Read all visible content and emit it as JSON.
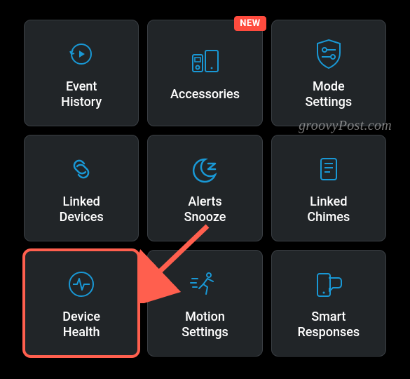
{
  "accent_color": "#1998d5",
  "highlight_color": "#ff5f4e",
  "badge_color": "#ff4b3e",
  "watermark": "groovyPost.com",
  "tiles": [
    {
      "label": "Event\nHistory",
      "icon": "clock-play",
      "badge": null,
      "highlight": false,
      "name": "tile-event-history"
    },
    {
      "label": "Accessories",
      "icon": "devices",
      "badge": "NEW",
      "highlight": false,
      "name": "tile-accessories"
    },
    {
      "label": "Mode\nSettings",
      "icon": "shield-toggle",
      "badge": null,
      "highlight": false,
      "name": "tile-mode-settings"
    },
    {
      "label": "Linked\nDevices",
      "icon": "link",
      "badge": null,
      "highlight": false,
      "name": "tile-linked-devices"
    },
    {
      "label": "Alerts\nSnooze",
      "icon": "moon-snooze",
      "badge": null,
      "highlight": false,
      "name": "tile-alerts-snooze"
    },
    {
      "label": "Linked\nChimes",
      "icon": "doc-lines",
      "badge": null,
      "highlight": false,
      "name": "tile-linked-chimes"
    },
    {
      "label": "Device\nHealth",
      "icon": "pulse-circle",
      "badge": null,
      "highlight": true,
      "name": "tile-device-health"
    },
    {
      "label": "Motion\nSettings",
      "icon": "runner",
      "badge": null,
      "highlight": false,
      "name": "tile-motion-settings"
    },
    {
      "label": "Smart\nResponses",
      "icon": "device-chat",
      "badge": null,
      "highlight": false,
      "name": "tile-smart-responses"
    }
  ]
}
